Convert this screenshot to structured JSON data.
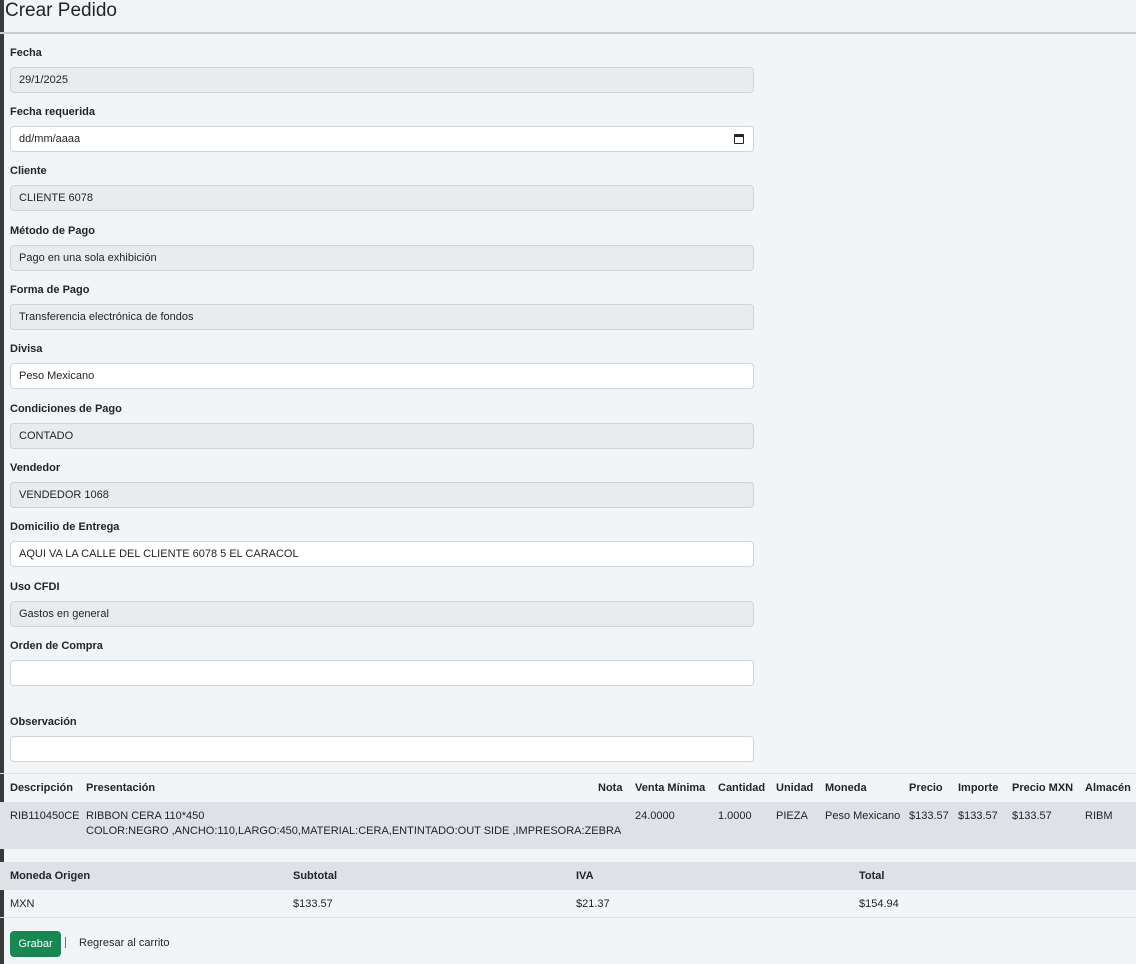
{
  "page": {
    "title": "Crear Pedido"
  },
  "form": {
    "fecha": {
      "label": "Fecha",
      "value": "29/1/2025"
    },
    "fecha_requerida": {
      "label": "Fecha requerida",
      "placeholder": "dd/mm/aaaa"
    },
    "cliente": {
      "label": "Cliente",
      "value": "CLIENTE 6078"
    },
    "metodo_pago": {
      "label": "Método de Pago",
      "value": "Pago en una sola exhibición"
    },
    "forma_pago": {
      "label": "Forma de Pago",
      "value": "Transferencia electrónica de fondos"
    },
    "divisa": {
      "label": "Divisa",
      "value": "Peso Mexicano"
    },
    "condiciones_pago": {
      "label": "Condiciones de Pago",
      "value": "CONTADO"
    },
    "vendedor": {
      "label": "Vendedor",
      "value": "VENDEDOR 1068"
    },
    "domicilio": {
      "label": "Domicilio de Entrega",
      "value": "AQUI VA LA CALLE DEL CLIENTE 6078 5 EL CARACOL"
    },
    "uso_cfdi": {
      "label": "Uso CFDI",
      "value": "Gastos en general"
    },
    "orden_compra": {
      "label": "Orden de Compra",
      "value": ""
    },
    "observacion": {
      "label": "Observación",
      "value": ""
    }
  },
  "products": {
    "headers": {
      "descripcion": "Descripción",
      "presentacion": "Presentación",
      "nota": "Nota",
      "venta_minima": "Venta Mínima",
      "cantidad": "Cantidad",
      "unidad": "Unidad",
      "moneda": "Moneda",
      "precio": "Precio",
      "importe": "Importe",
      "precio_mxn": "Precio MXN",
      "almacen": "Almacén"
    },
    "rows": [
      {
        "descripcion": "RIB110450CE",
        "presentacion_line1": "RIBBON CERA 110*450",
        "presentacion_line2": "COLOR:NEGRO ,ANCHO:110,LARGO:450,MATERIAL:CERA,ENTINTADO:OUT SIDE ,IMPRESORA:ZEBRA",
        "nota": "",
        "venta_minima": "24.0000",
        "cantidad": "1.0000",
        "unidad": "PIEZA",
        "moneda": "Peso Mexicano",
        "precio": "$133.57",
        "importe": "$133.57",
        "precio_mxn": "$133.57",
        "almacen": "RIBM"
      }
    ]
  },
  "totals": {
    "headers": {
      "moneda_origen": "Moneda Origen",
      "subtotal": "Subtotal",
      "iva": "IVA",
      "total": "Total"
    },
    "row": {
      "moneda_origen": "MXN",
      "subtotal": "$133.57",
      "iva": "$21.37",
      "total": "$154.94"
    }
  },
  "actions": {
    "save_label": "Grabar",
    "back_label": "Regresar al carrito"
  },
  "colors": {
    "save_button": "#198754",
    "readonly_bg": "#e9ecef",
    "page_bg": "#f2f5f8"
  }
}
